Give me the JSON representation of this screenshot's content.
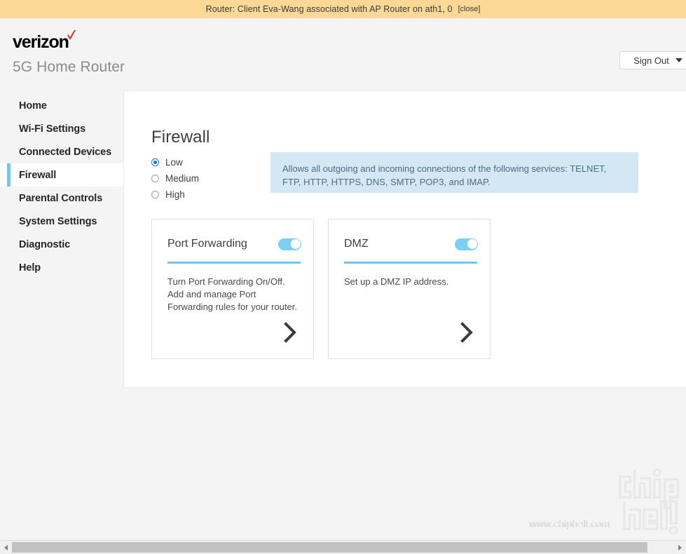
{
  "banner": {
    "message": "Router: Client Eva-Wang associated with AP Router on ath1, 0",
    "close_label": "[close]",
    "background_color": "#fbd896"
  },
  "header": {
    "brand": "verizon",
    "product_name": "5G Home Router",
    "sign_out_label": "Sign Out",
    "brand_check_color": "#e02020"
  },
  "sidebar": {
    "items": [
      {
        "label": "Home",
        "active": false
      },
      {
        "label": "Wi-Fi Settings",
        "active": false
      },
      {
        "label": "Connected Devices",
        "active": false
      },
      {
        "label": "Firewall",
        "active": true
      },
      {
        "label": "Parental Controls",
        "active": false
      },
      {
        "label": "System Settings",
        "active": false
      },
      {
        "label": "Diagnostic",
        "active": false
      },
      {
        "label": "Help",
        "active": false
      }
    ],
    "active_accent_color": "#6ec8f0"
  },
  "main": {
    "page_title": "Firewall",
    "security_levels": {
      "selected": "Low",
      "options": [
        {
          "label": "Low",
          "selected": true
        },
        {
          "label": "Medium",
          "selected": false
        },
        {
          "label": "High",
          "selected": false
        }
      ],
      "selected_color": "#1a73d9"
    },
    "info_box": {
      "text": "Allows all outgoing and incoming connections of the following services: TELNET, FTP, HTTP, HTTPS, DNS, SMTP, POP3, and IMAP.",
      "background_color": "#d3e8f3",
      "text_color": "#4a6e85"
    },
    "cards": [
      {
        "title": "Port Forwarding",
        "description": "Turn Port Forwarding On/Off. Add and manage Port Forwarding rules for your router.",
        "toggle_state": "on",
        "toggle_color": "#7ecdf2",
        "divider_color": "#6ec8f0"
      },
      {
        "title": "DMZ",
        "description": "Set up a DMZ IP address.",
        "toggle_state": "on",
        "toggle_color": "#7ecdf2",
        "divider_color": "#6ec8f0"
      }
    ]
  },
  "watermark": {
    "url": "www.chiphell.com",
    "logo_text": "chiphell"
  }
}
